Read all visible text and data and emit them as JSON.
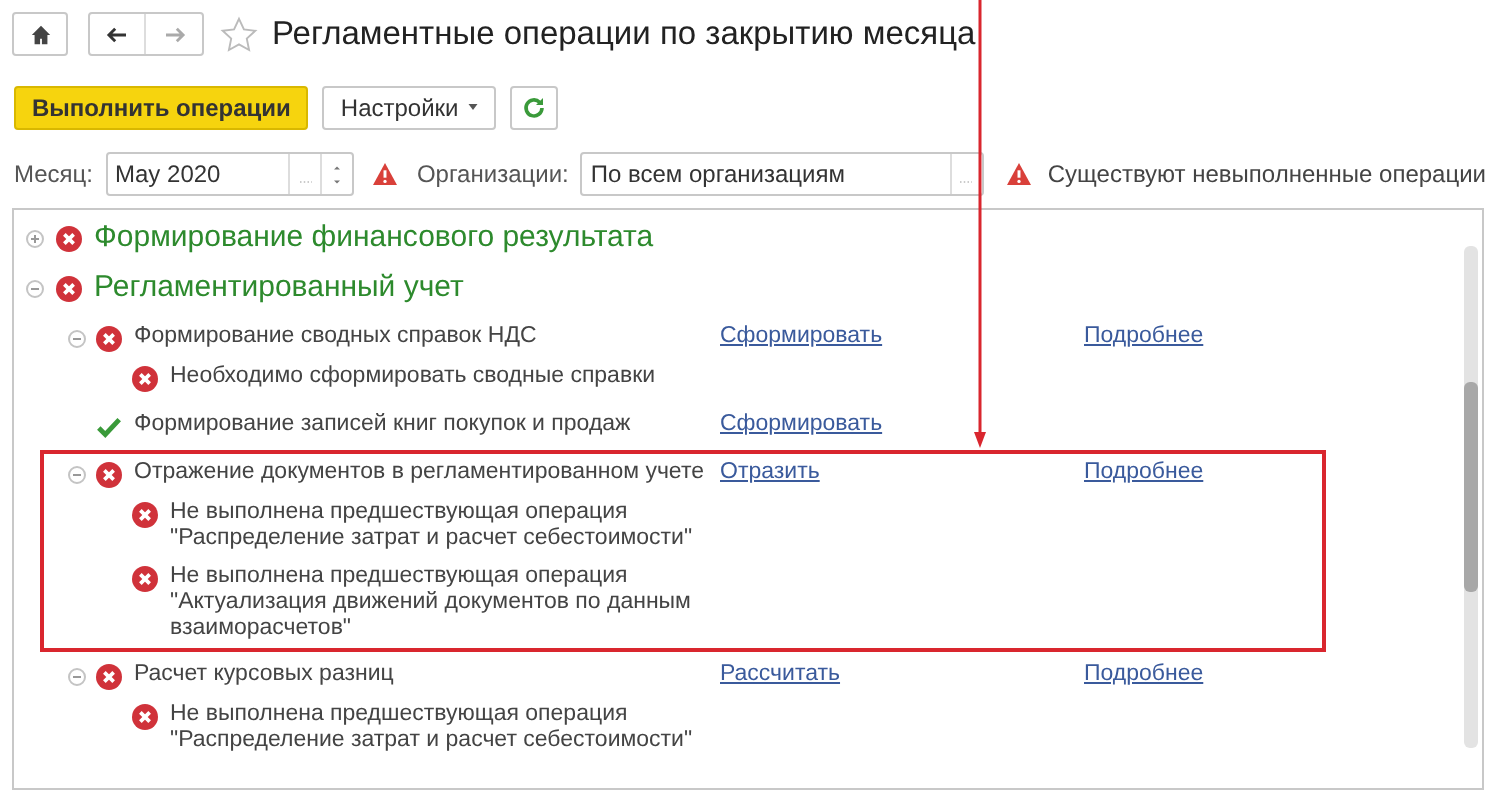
{
  "window": {
    "title": "Регламентные операции по закрытию месяца",
    "favorite": false
  },
  "toolbar": {
    "primary_button": "Выполнить операции",
    "settings_button": "Настройки"
  },
  "filters": {
    "month_label": "Месяц:",
    "month_value": "May 2020",
    "organizations_label": "Организации:",
    "organizations_value": "По всем организациям",
    "warning": "Существуют невыполненные операции"
  },
  "tree": [
    {
      "label": "Формирование финансового результата",
      "completed": false,
      "expanded": false
    },
    {
      "label": "Регламентированный учет",
      "completed": false,
      "expanded": true,
      "children": [
        {
          "label": "Формирование сводных справок НДС",
          "completed": false,
          "expanded": true,
          "highlighted": false,
          "action": "Сформировать",
          "details": "Подробнее",
          "messages": [
            "Необходимо сформировать сводные справки"
          ]
        },
        {
          "label": "Формирование записей книг покупок и продаж",
          "completed": true,
          "highlighted": false,
          "action": "Сформировать"
        },
        {
          "label": "Отражение документов в регламентированном учете",
          "completed": false,
          "expanded": true,
          "highlighted": true,
          "action": "Отразить",
          "details": "Подробнее",
          "messages": [
            "Не выполнена предшествующая операция\n\"Распределение затрат и расчет себестоимости\"",
            "Не выполнена предшествующая операция\n\"Актуализация движений документов по данным\nвзаиморасчетов\""
          ]
        },
        {
          "label": "Расчет курсовых разниц",
          "completed": false,
          "expanded": true,
          "highlighted": false,
          "action": "Рассчитать",
          "details": "Подробнее",
          "messages": [
            "Не выполнена предшествующая операция\n\"Распределение затрат и расчет себестоимости\""
          ]
        }
      ]
    }
  ]
}
